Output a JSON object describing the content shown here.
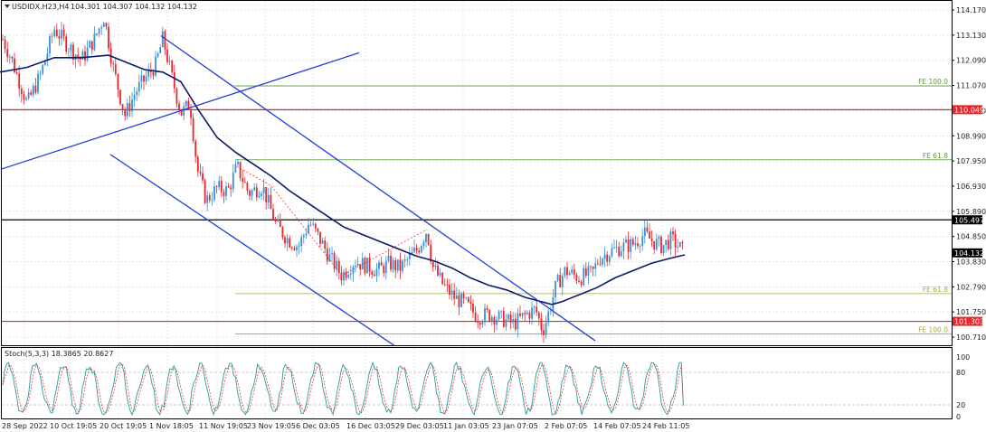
{
  "header": {
    "symbol_label": "USDIDX.H23,H4",
    "ohlc_label": "104.301 104.307 104.132 104.132"
  },
  "chart_data": [
    {
      "type": "candlestick",
      "title": "USDIDX.H23,H4",
      "y_ticks": [
        "114.170",
        "113.130",
        "112.090",
        "111.070",
        "110.030",
        "108.990",
        "107.950",
        "106.930",
        "105.890",
        "104.850",
        "103.830",
        "102.790",
        "101.750",
        "100.710"
      ],
      "ylim": [
        100.2,
        114.65
      ],
      "x_ticks": [
        "28 Sep 2022",
        "10 Oct 19:05",
        "20 Oct 19:05",
        "1 Nov 18:05",
        "11 Nov 19:05",
        "23 Nov 19:05",
        "6 Dec 03:05",
        "16 Dec 03:05",
        "29 Dec 03:05",
        "11 Jan 03:05",
        "23 Jan 07:05",
        "2 Feb 07:05",
        "14 Feb 07:05",
        "24 Feb 11:05"
      ],
      "price_path": [
        [
          0,
          113.2
        ],
        [
          12,
          112.2
        ],
        [
          30,
          110.3
        ],
        [
          45,
          111.5
        ],
        [
          60,
          113.4
        ],
        [
          75,
          112.7
        ],
        [
          90,
          112.1
        ],
        [
          105,
          113.0
        ],
        [
          115,
          113.9
        ],
        [
          125,
          111.8
        ],
        [
          138,
          109.8
        ],
        [
          150,
          110.8
        ],
        [
          162,
          111.4
        ],
        [
          172,
          111.9
        ],
        [
          180,
          113.0
        ],
        [
          190,
          111.4
        ],
        [
          200,
          109.9
        ],
        [
          210,
          110.3
        ],
        [
          218,
          107.6
        ],
        [
          228,
          106.3
        ],
        [
          240,
          106.8
        ],
        [
          252,
          106.7
        ],
        [
          262,
          107.7
        ],
        [
          275,
          106.6
        ],
        [
          290,
          106.9
        ],
        [
          305,
          105.3
        ],
        [
          318,
          104.7
        ],
        [
          330,
          104.4
        ],
        [
          342,
          105.4
        ],
        [
          355,
          104.6
        ],
        [
          365,
          103.9
        ],
        [
          378,
          103.2
        ],
        [
          392,
          103.8
        ],
        [
          405,
          103.6
        ],
        [
          418,
          103.4
        ],
        [
          430,
          103.7
        ],
        [
          442,
          103.5
        ],
        [
          452,
          103.9
        ],
        [
          462,
          104.3
        ],
        [
          472,
          105.1
        ],
        [
          478,
          103.6
        ],
        [
          490,
          102.8
        ],
        [
          502,
          102.3
        ],
        [
          515,
          102.0
        ],
        [
          528,
          101.5
        ],
        [
          540,
          101.6
        ],
        [
          555,
          101.4
        ],
        [
          568,
          101.2
        ],
        [
          582,
          101.6
        ],
        [
          592,
          101.8
        ],
        [
          600,
          100.9
        ],
        [
          606,
          101.6
        ],
        [
          615,
          102.8
        ],
        [
          625,
          103.4
        ],
        [
          640,
          103.1
        ],
        [
          655,
          103.3
        ],
        [
          662,
          103.9
        ],
        [
          675,
          104.2
        ],
        [
          690,
          104.4
        ],
        [
          700,
          104.5
        ],
        [
          712,
          104.9
        ],
        [
          722,
          104.6
        ],
        [
          732,
          104.4
        ],
        [
          742,
          104.7
        ],
        [
          750,
          104.4
        ],
        [
          757,
          104.13
        ]
      ],
      "moving_average": [
        [
          0,
          111.6
        ],
        [
          30,
          111.8
        ],
        [
          60,
          112.2
        ],
        [
          90,
          112.2
        ],
        [
          120,
          112.3
        ],
        [
          140,
          112.0
        ],
        [
          160,
          111.7
        ],
        [
          180,
          111.6
        ],
        [
          200,
          111.2
        ],
        [
          220,
          110.0
        ],
        [
          240,
          108.9
        ],
        [
          260,
          108.3
        ],
        [
          280,
          107.8
        ],
        [
          300,
          107.3
        ],
        [
          320,
          106.7
        ],
        [
          340,
          106.2
        ],
        [
          360,
          105.7
        ],
        [
          380,
          105.2
        ],
        [
          400,
          104.9
        ],
        [
          420,
          104.6
        ],
        [
          440,
          104.3
        ],
        [
          460,
          104.0
        ],
        [
          480,
          103.8
        ],
        [
          500,
          103.5
        ],
        [
          520,
          103.1
        ],
        [
          540,
          102.8
        ],
        [
          560,
          102.6
        ],
        [
          580,
          102.3
        ],
        [
          600,
          102.1
        ],
        [
          610,
          102.0
        ],
        [
          620,
          102.1
        ],
        [
          640,
          102.4
        ],
        [
          660,
          102.7
        ],
        [
          680,
          103.1
        ],
        [
          700,
          103.4
        ],
        [
          720,
          103.7
        ],
        [
          740,
          103.9
        ],
        [
          757,
          104.05
        ]
      ],
      "horizontal_levels": [
        {
          "value": 110.049,
          "label": "110.049",
          "color": "#e8262a"
        },
        {
          "value": 105.497,
          "label": "105.497",
          "color": "#000000"
        },
        {
          "value": 101.303,
          "label": "101.303",
          "color": "#e8262a"
        }
      ],
      "current_price": {
        "value": 104.132,
        "label": "104.132"
      },
      "fib_levels": [
        {
          "label": "FE 100.0",
          "value": 111.03,
          "color": "#5a9a3a"
        },
        {
          "label": "FE 61.8",
          "value": 107.98,
          "color": "#5a9a3a"
        },
        {
          "label": "FE 61.8",
          "value": 102.45,
          "color": "#a6a648"
        },
        {
          "label": "FE 100.0",
          "value": 100.78,
          "color": "#a6a648"
        }
      ],
      "trend_channels": [
        {
          "from": [
            178,
            113.1
          ],
          "to": [
            658,
            100.5
          ]
        },
        {
          "from": [
            122,
            108.2
          ],
          "to": [
            436,
            100.3
          ]
        },
        {
          "from": [
            2,
            107.6
          ],
          "to": [
            397,
            112.4
          ]
        }
      ],
      "colors": {
        "up": "#3a8fd9",
        "down": "#e8262a",
        "ma": "#0a1a6e",
        "channel": "#1f3fd6"
      }
    },
    {
      "type": "line",
      "title": "Stoch(5,3,3) 18.3865 20.8627",
      "y_ticks": [
        "100",
        "80",
        "20",
        "0"
      ],
      "ylim": [
        0,
        100
      ],
      "series": [
        {
          "name": "main",
          "color": "#2a9aa0"
        },
        {
          "name": "signal",
          "color": "#e8262a"
        }
      ],
      "last_values": {
        "main": 18.3865,
        "signal": 20.8627
      }
    }
  ]
}
